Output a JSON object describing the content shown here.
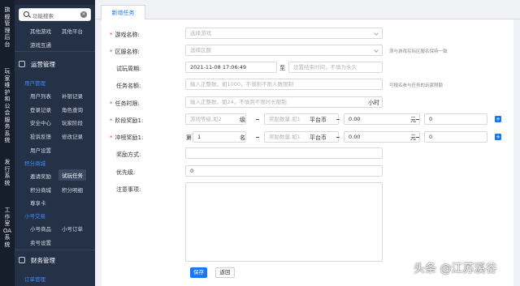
{
  "rail": {
    "items": [
      "旗舰管理后台",
      "玩家维护和公会服务系统",
      "发行系统",
      "工作室OA系统"
    ]
  },
  "sidebar": {
    "search_placeholder": "功能搜索",
    "top_row": {
      "left": "其他游戏",
      "right": "其他平台"
    },
    "game_interop": "游戏互通",
    "group_ops": "运营管理",
    "sub_user": "用户管理",
    "row1": {
      "left": "用户列表",
      "right": "补银记录"
    },
    "row2": {
      "left": "登录记录",
      "right": "角色查询"
    },
    "row3": {
      "left": "安全中心",
      "right": "玩家阶段"
    },
    "row4": {
      "left": "投诉反馈",
      "right": "修改记录"
    },
    "user_settings": "用户设置",
    "sub_points": "积分商城",
    "row5": {
      "left": "邀请奖励",
      "right": "试玩任务"
    },
    "row6": {
      "left": "积分商城",
      "right": "积分明细"
    },
    "vip_card": "尊享卡",
    "sub_small": "小号交易",
    "row7": {
      "left": "小号商品",
      "right": "小号订单"
    },
    "sell_settings": "卖号设置",
    "group_finance": "财务管理",
    "sub_order": "订单管理"
  },
  "tab": {
    "label": "新增任务"
  },
  "form": {
    "game_name": {
      "label": "游戏名称:",
      "placeholder": "选择游戏"
    },
    "server_name": {
      "label": "区服名称:",
      "placeholder": "选择区服",
      "hint": "须与游戏实际区服名保持一致"
    },
    "trial_period": {
      "label": "试玩周期:",
      "start": "2021-11-08 17:06:49",
      "to": "至",
      "end_placeholder": "设置结束时间，不填为永久"
    },
    "task_name": {
      "label": "任务名额:",
      "placeholder": "输入正整数，如1000，不填则不限人数限制",
      "hint": "可报名参与任务的玩家限额"
    },
    "task_time": {
      "label": "任务时限:",
      "placeholder": "输入正整数，如24，不填则不限时长限制",
      "unit": "小时"
    },
    "stage_reward": {
      "label": "阶段奖励1:",
      "level_placeholder": "游戏等级,如2",
      "level_unit": "级",
      "amount_placeholder": "奖励数量,如1",
      "currency": "平台币",
      "amount_value": "0.00",
      "yuan": "元",
      "extra_value": "0"
    },
    "rank_reward": {
      "label": "冲榜奖励1:",
      "prefix": "第",
      "rank_value": "1",
      "rank_unit": "名",
      "amount_placeholder": "奖励数量,如1",
      "currency": "平台币",
      "amount_value": "0.00",
      "yuan": "元",
      "extra_value": "0"
    },
    "reward_method": {
      "label": "奖励方式:"
    },
    "priority": {
      "label": "优先级:",
      "value": "0"
    },
    "notes": {
      "label": "注意事项:"
    },
    "save_label": "保存",
    "back_label": "返回"
  },
  "watermark": "头条 @江苏溪谷"
}
